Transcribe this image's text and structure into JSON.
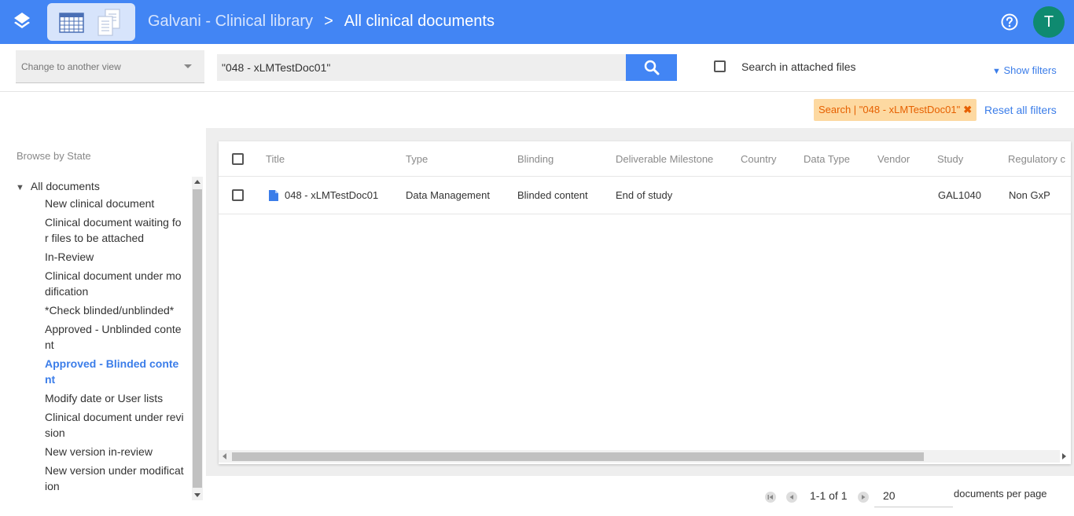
{
  "header": {
    "app_name": "Galvani - Clinical library",
    "separator": ">",
    "current_view": "All clinical documents",
    "avatar_letter": "T",
    "colors": {
      "bar": "#4285f4",
      "avatar": "#0f8a70"
    }
  },
  "toolbar": {
    "view_select_placeholder": "Change to another view",
    "search_value": "\"048 - xLMTestDoc01\"",
    "attached_files_label": "Search in attached files",
    "show_filters_label": "Show filters"
  },
  "filters": {
    "active_chip": "Search | \"048 - xLMTestDoc01\"",
    "chip_close": "✖",
    "reset_label": "Reset all filters"
  },
  "sidebar": {
    "title": "Browse by State",
    "root_label": "All documents",
    "items": [
      {
        "label": "New clinical document",
        "active": false
      },
      {
        "label": "Clinical document waiting for files to be attached",
        "active": false
      },
      {
        "label": "In-Review",
        "active": false
      },
      {
        "label": "Clinical document under modification",
        "active": false
      },
      {
        "label": "*Check blinded/unblinded*",
        "active": false
      },
      {
        "label": "Approved - Unblinded content",
        "active": false
      },
      {
        "label": "Approved - Blinded content",
        "active": true
      },
      {
        "label": "Modify date or User lists",
        "active": false
      },
      {
        "label": "Clinical document under revision",
        "active": false
      },
      {
        "label": "New version in-review",
        "active": false
      },
      {
        "label": "New version under modification",
        "active": false
      }
    ]
  },
  "grid": {
    "columns": [
      "Title",
      "Type",
      "Blinding",
      "Deliverable Milestone",
      "Country",
      "Data Type",
      "Vendor",
      "Study",
      "Regulatory c"
    ],
    "rows": [
      {
        "title": "048 - xLMTestDoc01",
        "type": "Data Management",
        "blinding": "Blinded content",
        "milestone": "End of study",
        "country": "",
        "data_type": "",
        "vendor": "",
        "study": "GAL1040",
        "regulatory": "Non GxP"
      }
    ]
  },
  "pager": {
    "range": "1-1 of 1",
    "per_page": "20",
    "per_page_label": "documents per page"
  }
}
